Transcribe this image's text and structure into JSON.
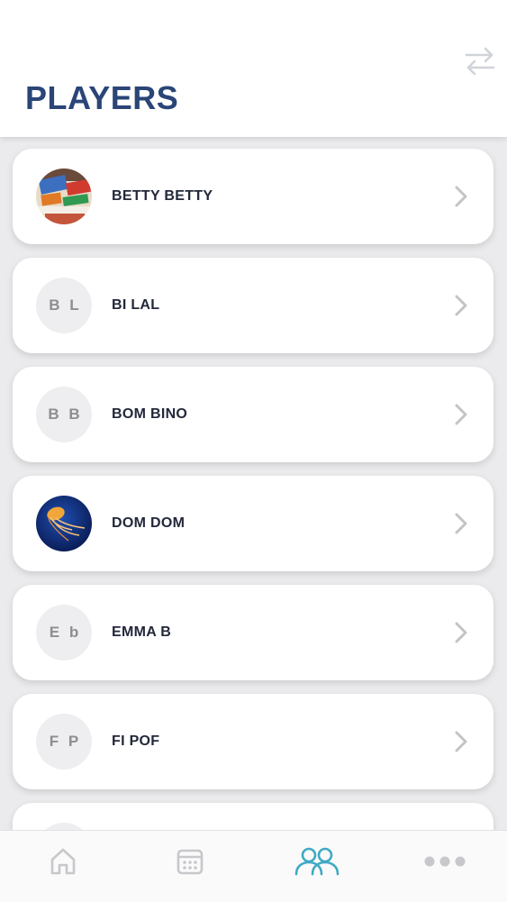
{
  "header": {
    "title": "PLAYERS",
    "swap_icon": "swap-arrows-icon"
  },
  "players": [
    {
      "name": "BETTY BETTY",
      "avatar": "photo",
      "initials": ""
    },
    {
      "name": "BI LAL",
      "avatar": "initials",
      "initials": "B L"
    },
    {
      "name": "BOM BINO",
      "avatar": "initials",
      "initials": "B B"
    },
    {
      "name": "DOM DOM",
      "avatar": "photo",
      "initials": ""
    },
    {
      "name": "EMMA B",
      "avatar": "initials",
      "initials": "E b"
    },
    {
      "name": "FI POF",
      "avatar": "initials",
      "initials": "F P"
    },
    {
      "name": "",
      "avatar": "initials",
      "initials": ""
    }
  ],
  "tabbar": {
    "items": [
      {
        "icon": "home-icon",
        "active": false
      },
      {
        "icon": "calendar-icon",
        "active": false
      },
      {
        "icon": "players-icon",
        "active": true
      },
      {
        "icon": "more-icon",
        "active": false
      }
    ],
    "active_color": "#3fa9c4",
    "inactive_color": "#c7c7cc"
  },
  "colors": {
    "title": "#2a4577",
    "background": "#ebebed"
  }
}
